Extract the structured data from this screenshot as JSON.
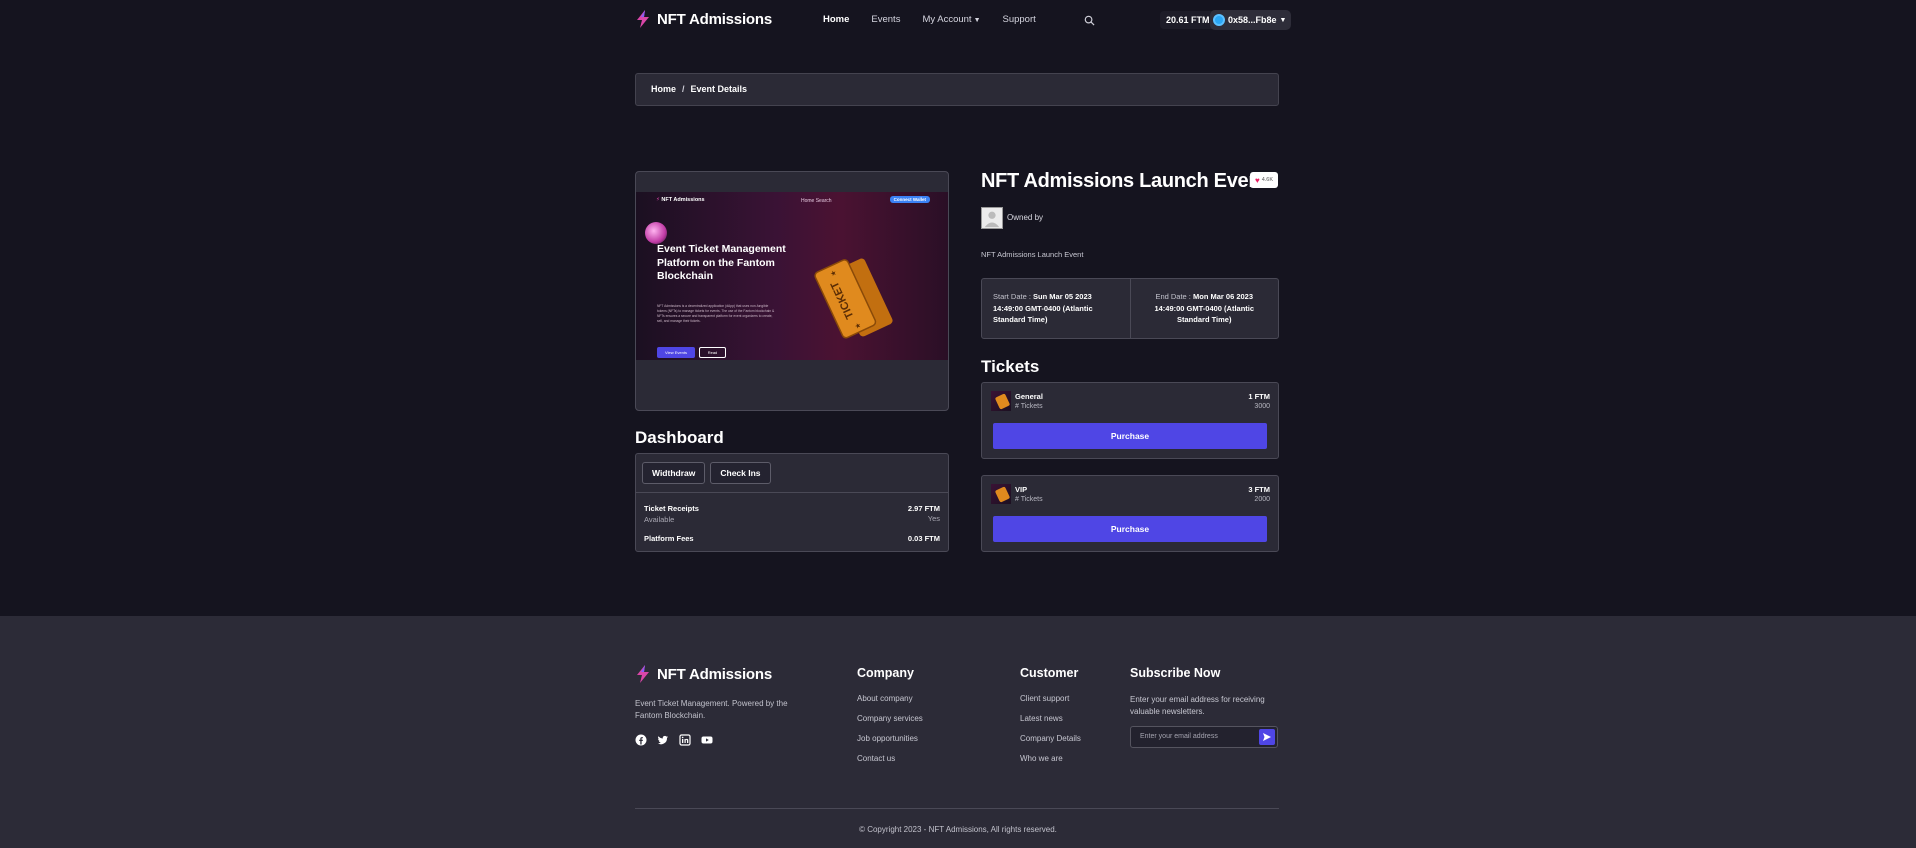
{
  "header": {
    "brand": "NFT Admissions",
    "nav": [
      "Home",
      "Events",
      "My Account",
      "Support"
    ],
    "balance": "20.61 FTM",
    "wallet": "0x58...Fb8e"
  },
  "breadcrumb": {
    "home": "Home",
    "sep": "/",
    "current": "Event Details"
  },
  "preview": {
    "brand": "NFT Admissions",
    "nav_links": "Home     Search",
    "connect": "Connect Wallet",
    "title": "Event Ticket Management Platform on the Fantom Blockchain",
    "desc": "NFT Admissions is a decentralized application (dApp) that uses non-fungible tokens (NFTs) to manage tickets for events. The use of the Fantom blockchain & NFTs ensures a secure and transparent platform for event organizers to create, sell, and manage their tickets.",
    "btn1": "View Events",
    "btn2": "Read"
  },
  "dashboard": {
    "title": "Dashboard",
    "tabs": [
      "Widthdraw",
      "Check Ins"
    ],
    "rows": [
      {
        "label": "Ticket Receipts",
        "value": "2.97 FTM",
        "sub_label": "Available",
        "sub_value": "Yes"
      },
      {
        "label": "Platform Fees",
        "value": "0.03 FTM"
      }
    ]
  },
  "event": {
    "title": "NFT Admissions Launch Event",
    "likes": "4.6K",
    "owned_by": "Owned by",
    "subtitle": "NFT Admissions Launch Event",
    "start_label": "Start Date :",
    "start_value": "Sun Mar 05 2023 14:49:00 GMT-0400 (Atlantic Standard Time)",
    "end_label": "End Date :",
    "end_value": "Mon Mar 06 2023 14:49:00 GMT-0400 (Atlantic Standard Time)"
  },
  "tickets": {
    "title": "Tickets",
    "items": [
      {
        "name": "General",
        "sub": "# Tickets",
        "price": "1 FTM",
        "qty": "3000",
        "button": "Purchase"
      },
      {
        "name": "VIP",
        "sub": "# Tickets",
        "price": "3 FTM",
        "qty": "2000",
        "button": "Purchase"
      }
    ]
  },
  "footer": {
    "brand": "NFT Admissions",
    "description": "Event Ticket Management. Powered by the Fantom Blockchain.",
    "company": {
      "title": "Company",
      "links": [
        "About company",
        "Company services",
        "Job opportunities",
        "Contact us"
      ]
    },
    "customer": {
      "title": "Customer",
      "links": [
        "Client support",
        "Latest news",
        "Company Details",
        "Who we are"
      ]
    },
    "subscribe": {
      "title": "Subscribe Now",
      "desc": "Enter your email address for receiving valuable newsletters.",
      "placeholder": "Enter your email address"
    },
    "copyright": "© Copyright 2023 - NFT Admissions, All rights reserved."
  },
  "colors": {
    "accent": "#4f46e5",
    "background": "#15141f",
    "card": "#2b2a36",
    "footer": "#2c2b37"
  }
}
